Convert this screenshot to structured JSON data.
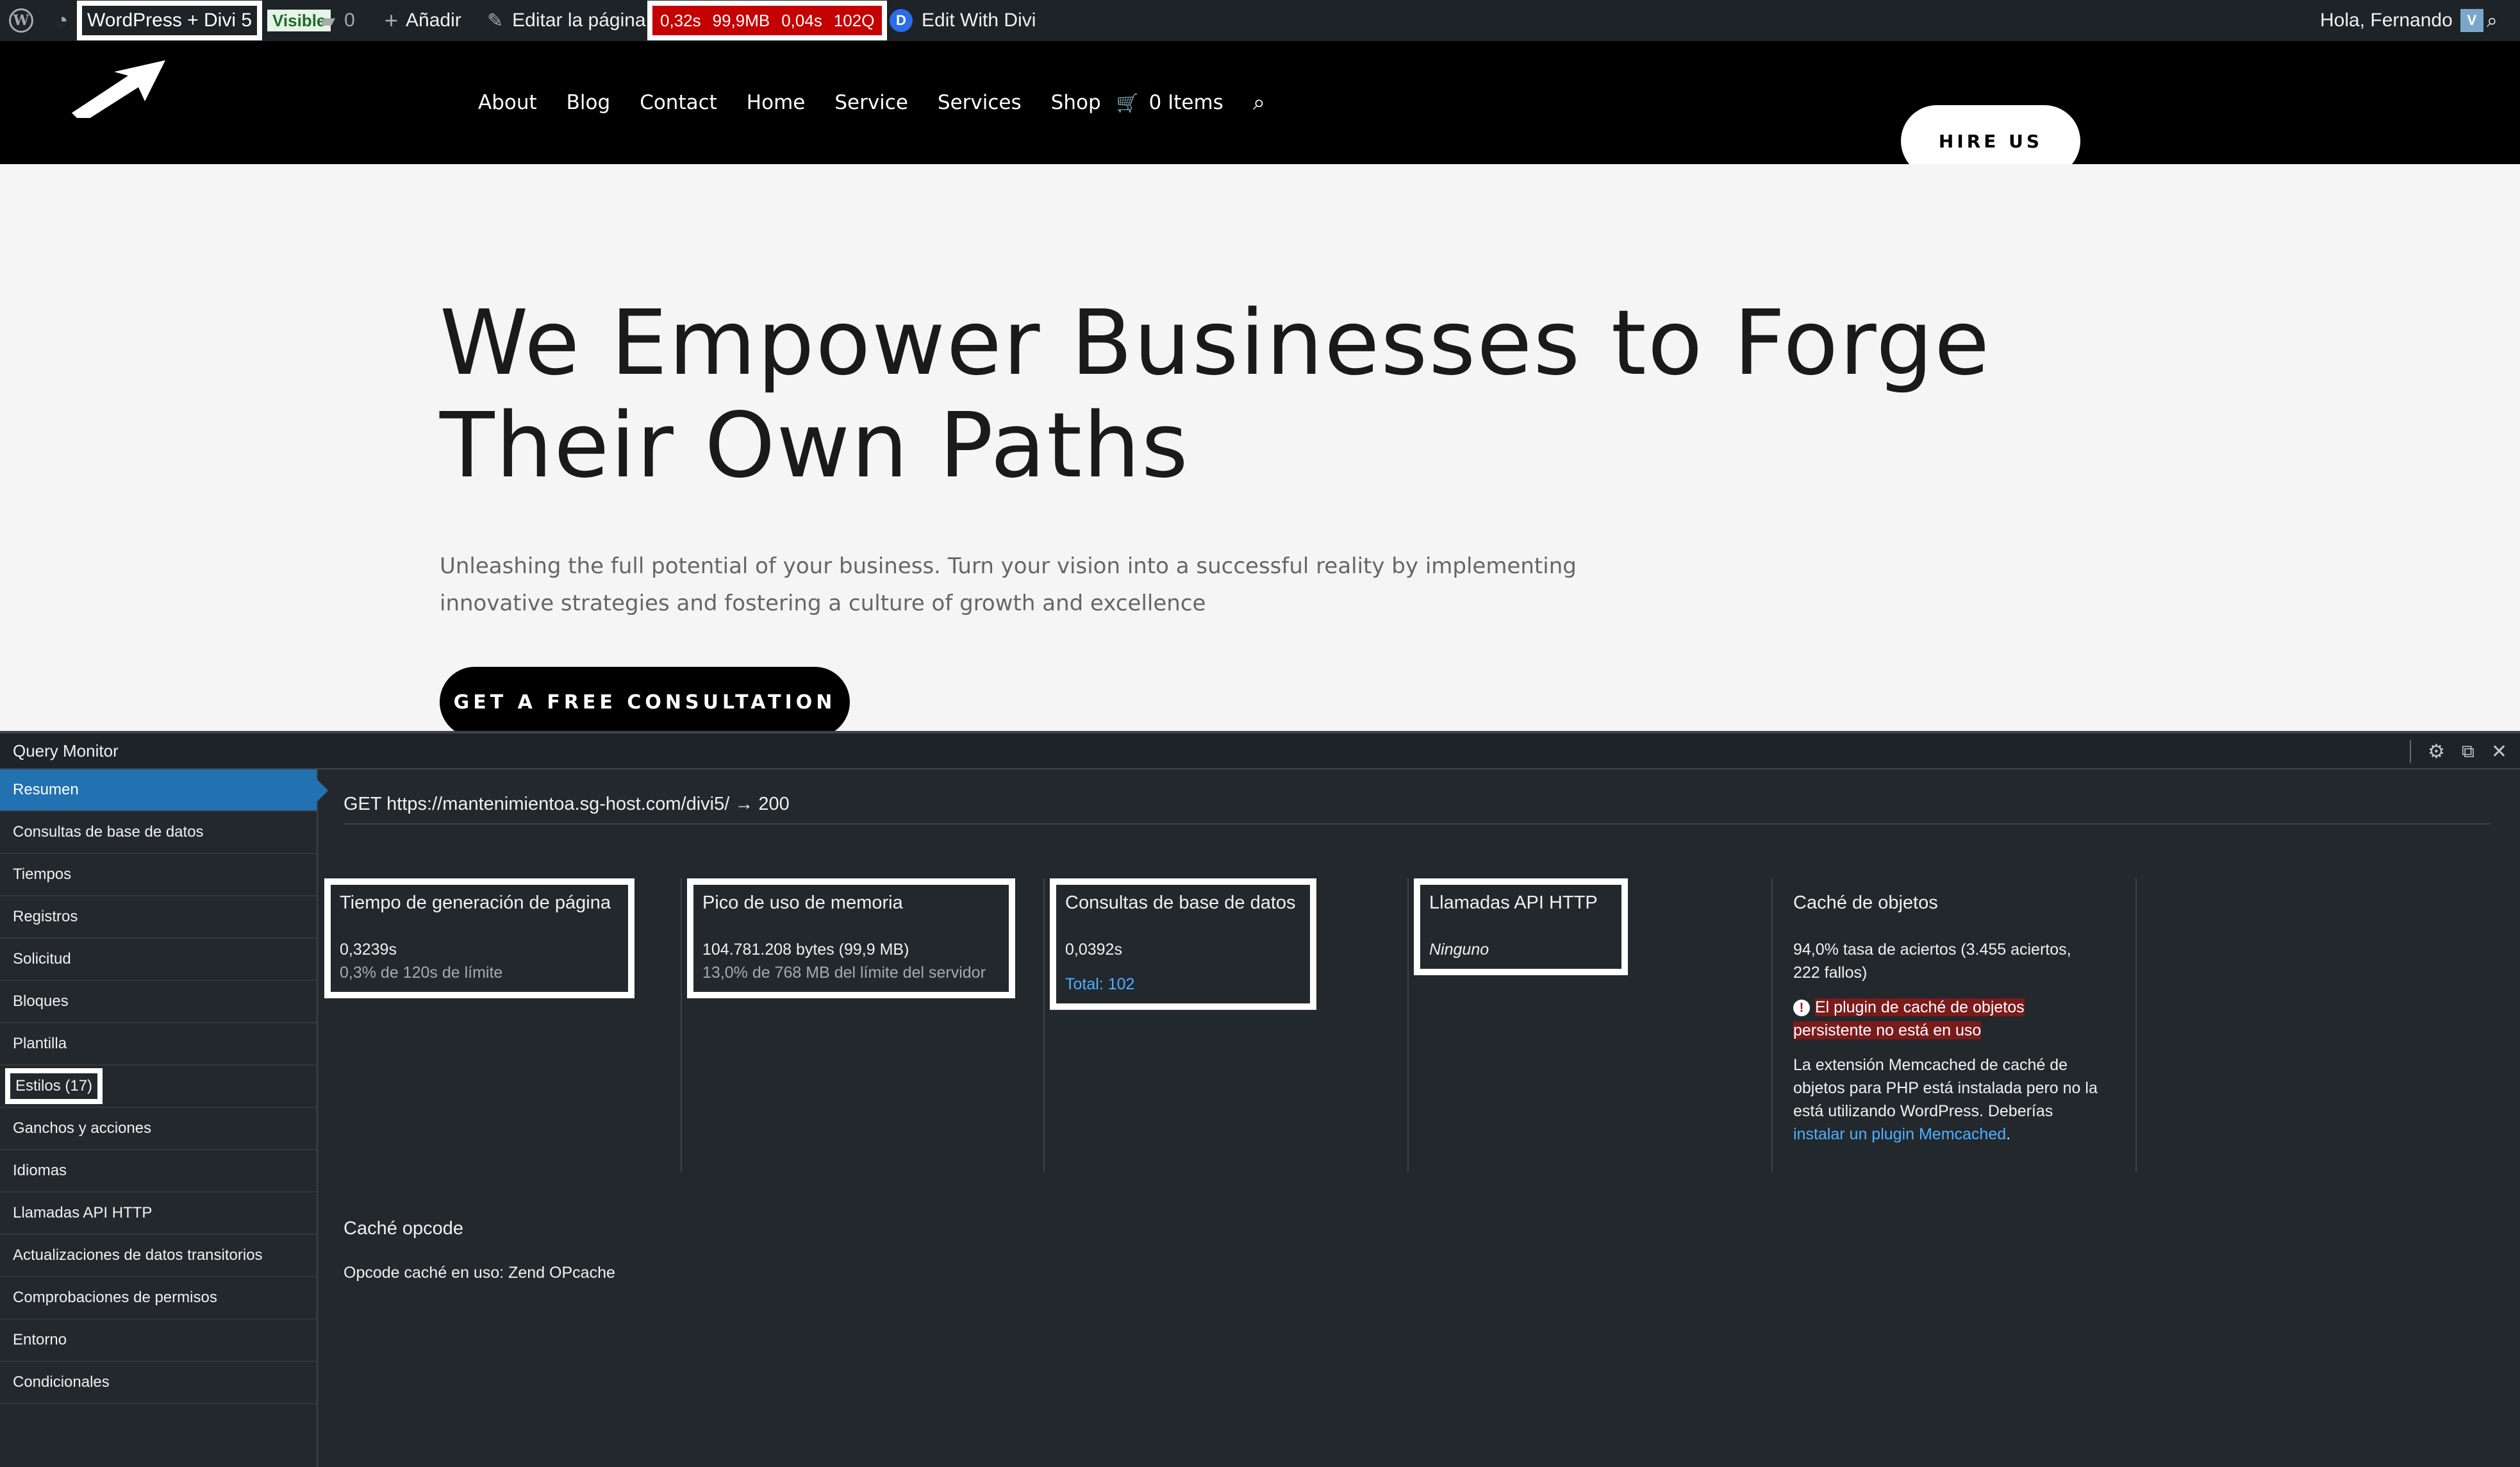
{
  "admin_bar": {
    "wp_logo": "wordpress-icon",
    "site_name": "WordPress + Divi 5",
    "visibility_badge": "Visible",
    "comments_count": "0",
    "new_label": "Añadir",
    "edit_page_label": "Editar la página",
    "qm_stats": {
      "time": "0,32s",
      "memory": "99,9MB",
      "db_time": "0,04s",
      "queries": "102Q"
    },
    "divi_label": "Edit With Divi",
    "greeting": "Hola, Fernando"
  },
  "site_header": {
    "nav": [
      "About",
      "Blog",
      "Contact",
      "Home",
      "Service",
      "Services",
      "Shop"
    ],
    "cart_label": "0 Items",
    "hire_button": "HIRE US"
  },
  "hero": {
    "title_line1": "We Empower Businesses to Forge",
    "title_line2": "Their Own Paths",
    "subtitle_line1": "Unleashing the full potential of your business. Turn your vision into a successful reality by implementing",
    "subtitle_line2": "innovative strategies and fostering a culture of growth and excellence",
    "cta": "GET A FREE CONSULTATION"
  },
  "query_monitor": {
    "title": "Query Monitor",
    "nav": [
      "Resumen",
      "Consultas de base de datos",
      "Tiempos",
      "Registros",
      "Solicitud",
      "Bloques",
      "Plantilla",
      "Estilos (17)",
      "Ganchos y acciones",
      "Idiomas",
      "Llamadas API HTTP",
      "Actualizaciones de datos transitorios",
      "Comprobaciones de permisos",
      "Entorno",
      "Condicionales"
    ],
    "request": "GET https://mantenimientoa.sg-host.com/divi5/ → 200",
    "page_gen": {
      "title": "Tiempo de generación de página",
      "value": "0,3239s",
      "detail": "0,3% de 120s de límite"
    },
    "memory": {
      "title": "Pico de uso de memoria",
      "value": "104.781.208 bytes (99,9 MB)",
      "detail": "13,0% de 768 MB del límite del servidor"
    },
    "db": {
      "title": "Consultas de base de datos",
      "value": "0,0392s",
      "total": "Total: 102"
    },
    "http": {
      "title": "Llamadas API HTTP",
      "value": "Ninguno"
    },
    "object_cache": {
      "title": "Caché de objetos",
      "rate_line1": "94,0% tasa de aciertos (3.455 aciertos,",
      "rate_line2": "222 fallos)",
      "warning_line1": "El plugin de caché de objetos",
      "warning_line2": "persistente no está en uso",
      "info_line1": "La extensión Memcached de caché de",
      "info_line2": "objetos para PHP está instalada pero no la",
      "info_line3": "está utilizando WordPress. Deberías",
      "info_link": "instalar un plugin Memcached",
      "info_end": "."
    },
    "opcode": {
      "title": "Caché opcode",
      "value": "Opcode caché en uso: Zend OPcache"
    }
  }
}
